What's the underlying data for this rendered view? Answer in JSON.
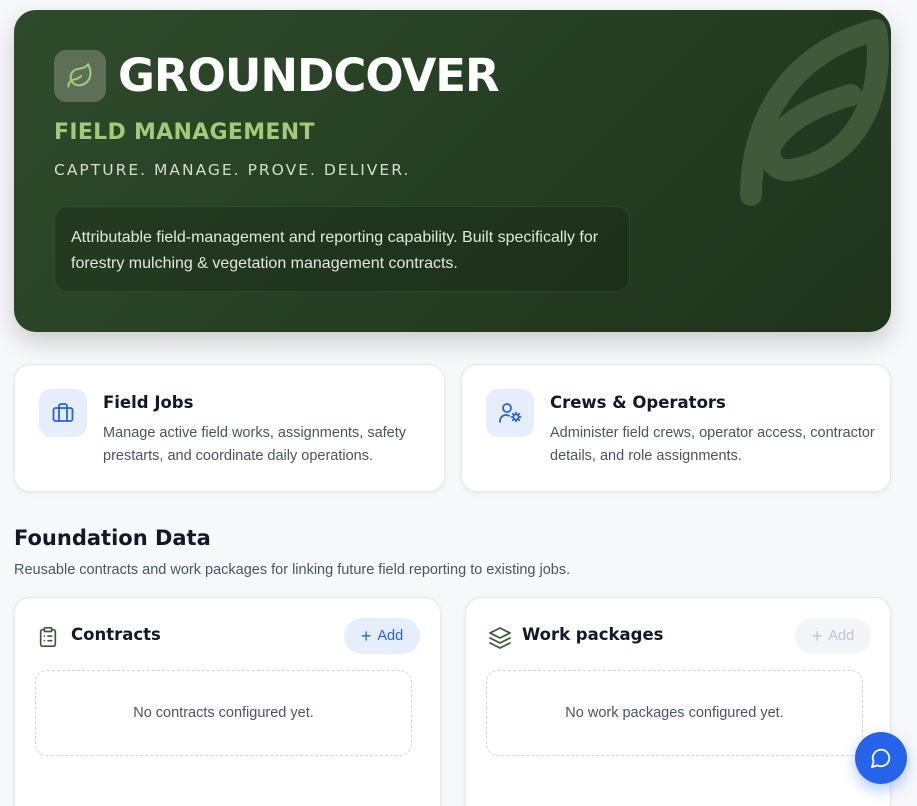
{
  "hero": {
    "title": "GROUNDCOVER",
    "subtitle": "FIELD MANAGEMENT",
    "tagline": "CAPTURE. MANAGE. PROVE. DELIVER.",
    "description": "Attributable field-management and reporting capability. Built specifically for forestry mulching & vegetation management contracts.",
    "logo_icon": "leaf-icon"
  },
  "nav_cards": [
    {
      "title": "Field Jobs",
      "description": "Manage active field works, assignments, safety prestarts, and coordinate daily operations.",
      "icon": "briefcase-icon"
    },
    {
      "title": "Crews & Operators",
      "description": "Administer field crews, operator access, contractor details, and role assignments.",
      "icon": "user-cog-icon"
    }
  ],
  "foundation": {
    "title": "Foundation Data",
    "subtitle": "Reusable contracts and work packages for linking future field reporting to existing jobs.",
    "cards": [
      {
        "title": "Contracts",
        "add_label": "Add",
        "empty_text": "No contracts configured yet.",
        "icon": "clipboard-list-icon",
        "add_enabled": true
      },
      {
        "title": "Work packages",
        "add_label": "Add",
        "empty_text": "No work packages configured yet.",
        "icon": "layers-icon",
        "add_enabled": false
      }
    ]
  },
  "chat": {
    "icon": "chat-bubble-icon"
  },
  "colors": {
    "hero_bg": "#2a4427",
    "accent_green": "#a3c979",
    "primary_blue": "#2563eb",
    "icon_tile_blue": "#e6edfd",
    "icon_green": "#3f5a36"
  }
}
